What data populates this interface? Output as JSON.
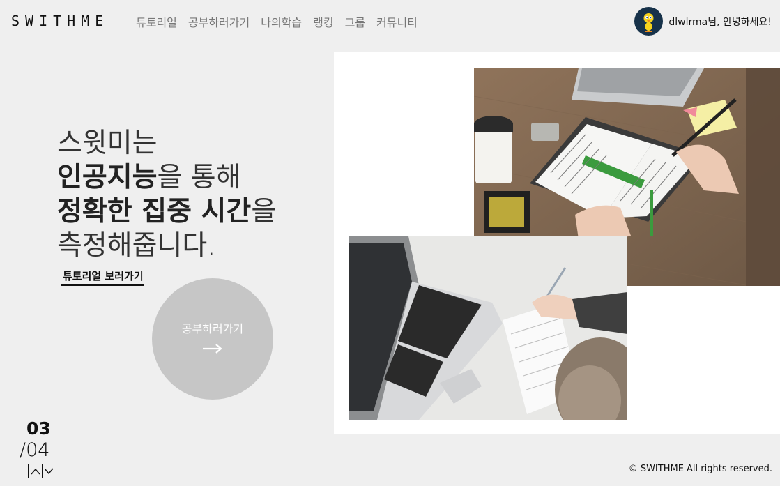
{
  "header": {
    "logo": "SWITHME",
    "nav": [
      "튜토리얼",
      "공부하러가기",
      "나의학습",
      "랭킹",
      "그룹",
      "커뮤니티"
    ],
    "user_greeting": "dlwlrma님, 안녕하세요!"
  },
  "hero": {
    "line1": "스윗미는",
    "line2_bold": "인공지능",
    "line2_rest": "을 통해",
    "line3_bold": "정확한 집중 시간",
    "line3_rest": "을",
    "line4": "측정해줍니다."
  },
  "tutorial_link": "튜토리얼 보러가기",
  "study_button": {
    "label": "공부하러가기",
    "icon": "arrow-right-icon"
  },
  "pagination": {
    "current": "03",
    "total": "/04"
  },
  "footer": {
    "copyright": "© SWITHME All rights reserved."
  },
  "colors": {
    "background": "#efefef",
    "circle": "#c6c6c6",
    "panel": "#ffffff"
  }
}
